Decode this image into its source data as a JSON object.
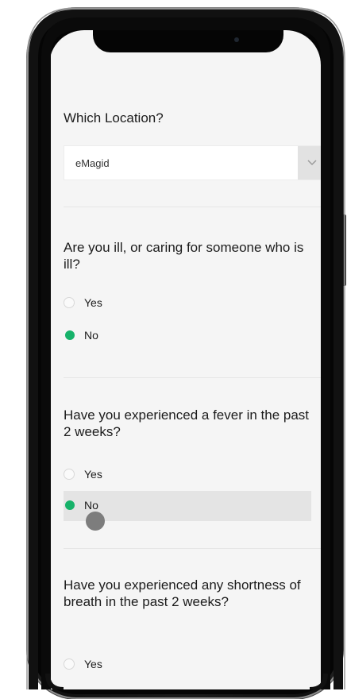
{
  "questions": {
    "location": {
      "title": "Which Location?",
      "selected": "eMagid",
      "arrow_icon": "chevron-down-icon"
    },
    "ill": {
      "title": "Are you ill, or caring for someone who is ill?",
      "options": [
        {
          "label": "Yes",
          "checked": false
        },
        {
          "label": "No",
          "checked": true
        }
      ]
    },
    "fever": {
      "title": "Have you experienced a fever in the past 2 weeks?",
      "options": [
        {
          "label": "Yes",
          "checked": false
        },
        {
          "label": "No",
          "checked": true
        }
      ]
    },
    "breath": {
      "title": "Have you experienced any shortness of breath in the past 2 weeks?",
      "options": [
        {
          "label": "Yes",
          "checked": false
        }
      ]
    }
  },
  "colors": {
    "accent": "#17b26a",
    "screen_bg": "#f5f5f5",
    "frame": "#111111"
  }
}
